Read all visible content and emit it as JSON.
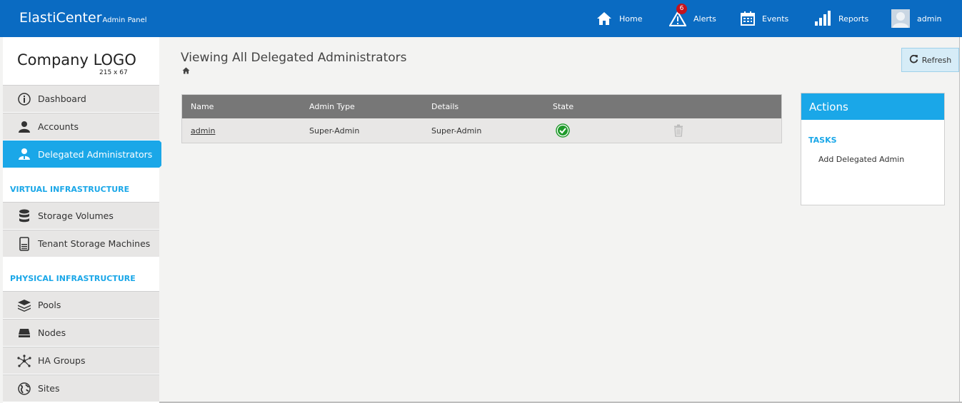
{
  "header": {
    "brand_name": "ElastiCenter",
    "brand_sub": "Admin Panel",
    "nav": [
      {
        "label": "Home",
        "icon": "home-icon"
      },
      {
        "label": "Alerts",
        "icon": "alert-icon",
        "badge": "6"
      },
      {
        "label": "Events",
        "icon": "calendar-icon"
      },
      {
        "label": "Reports",
        "icon": "bar-chart-icon"
      },
      {
        "label": "admin",
        "icon": "avatar"
      }
    ]
  },
  "sidebar": {
    "logo_text": "Company LOGO",
    "logo_size": "215 x 67",
    "items": [
      {
        "label": "Dashboard",
        "icon": "info-icon"
      },
      {
        "label": "Accounts",
        "icon": "user-icon"
      },
      {
        "label": "Delegated Administrators",
        "icon": "admin-icon",
        "active": true
      }
    ],
    "sections": [
      {
        "heading": "VIRTUAL INFRASTRUCTURE",
        "items": [
          {
            "label": "Storage Volumes",
            "icon": "database-icon"
          },
          {
            "label": "Tenant Storage Machines",
            "icon": "server-icon"
          }
        ]
      },
      {
        "heading": "PHYSICAL INFRASTRUCTURE",
        "items": [
          {
            "label": "Pools",
            "icon": "layers-icon"
          },
          {
            "label": "Nodes",
            "icon": "node-icon"
          },
          {
            "label": "HA Groups",
            "icon": "network-icon"
          },
          {
            "label": "Sites",
            "icon": "globe-icon"
          }
        ]
      }
    ]
  },
  "main": {
    "title": "Viewing All Delegated Administrators",
    "refresh_label": "Refresh",
    "table": {
      "columns": [
        "Name",
        "Admin Type",
        "Details",
        "State"
      ],
      "rows": [
        {
          "name": "admin",
          "admin_type": "Super-Admin",
          "details": "Super-Admin",
          "state": "ok"
        }
      ]
    },
    "actions": {
      "title": "Actions",
      "tasks_heading": "TASKS",
      "tasks": [
        "Add Delegated Admin"
      ]
    }
  },
  "colors": {
    "topbar": "#0a6bc2",
    "accent": "#1aa7e8",
    "badge": "#c4121c",
    "state_ok": "#1f9a2b"
  }
}
